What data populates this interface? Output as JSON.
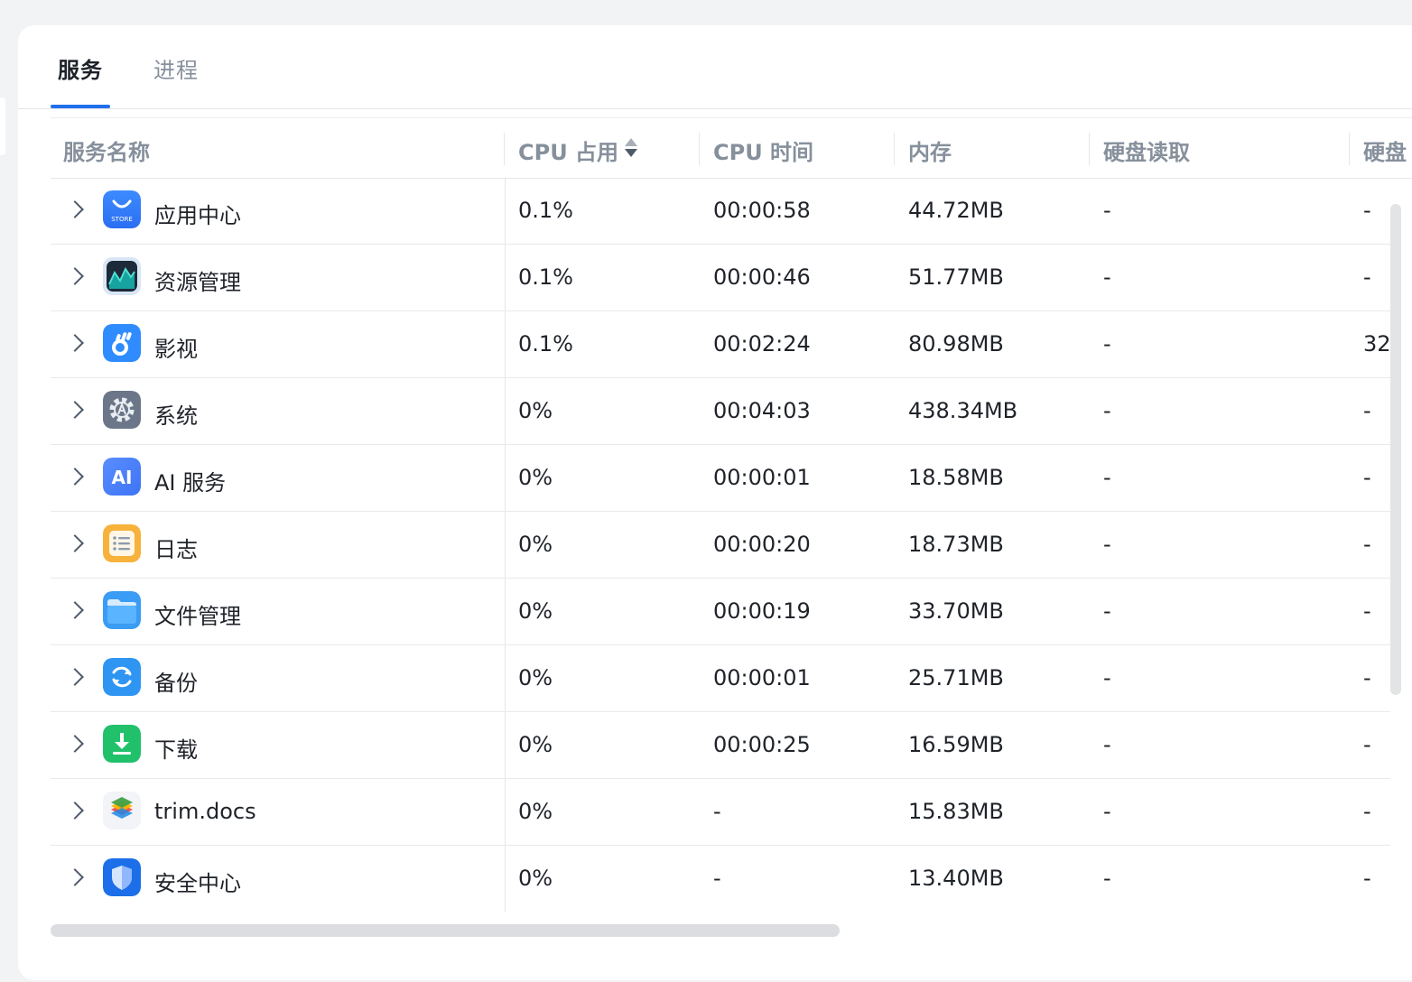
{
  "tabs": [
    {
      "label": "服务",
      "active": true
    },
    {
      "label": "进程",
      "active": false
    }
  ],
  "columns": {
    "name": "服务名称",
    "cpu": "CPU 占用",
    "cpu_time": "CPU 时间",
    "memory": "内存",
    "disk_read": "硬盘读取",
    "disk_write": "硬盘"
  },
  "rows": [
    {
      "name": "应用中心",
      "icon": "app-store-icon",
      "cpu": "0.1%",
      "time": "00:00:58",
      "mem": "44.72MB",
      "read": "-",
      "write": "-"
    },
    {
      "name": "资源管理",
      "icon": "resource-monitor-icon",
      "cpu": "0.1%",
      "time": "00:00:46",
      "mem": "51.77MB",
      "read": "-",
      "write": "-"
    },
    {
      "name": "影视",
      "icon": "video-icon",
      "cpu": "0.1%",
      "time": "00:02:24",
      "mem": "80.98MB",
      "read": "-",
      "write": "32"
    },
    {
      "name": "系统",
      "icon": "system-gear-icon",
      "cpu": "0%",
      "time": "00:04:03",
      "mem": "438.34MB",
      "read": "-",
      "write": "-"
    },
    {
      "name": "AI 服务",
      "icon": "ai-icon",
      "cpu": "0%",
      "time": "00:00:01",
      "mem": "18.58MB",
      "read": "-",
      "write": "-"
    },
    {
      "name": "日志",
      "icon": "log-icon",
      "cpu": "0%",
      "time": "00:00:20",
      "mem": "18.73MB",
      "read": "-",
      "write": "-"
    },
    {
      "name": "文件管理",
      "icon": "folder-icon",
      "cpu": "0%",
      "time": "00:00:19",
      "mem": "33.70MB",
      "read": "-",
      "write": "-"
    },
    {
      "name": "备份",
      "icon": "backup-icon",
      "cpu": "0%",
      "time": "00:00:01",
      "mem": "25.71MB",
      "read": "-",
      "write": "-"
    },
    {
      "name": "下载",
      "icon": "download-icon",
      "cpu": "0%",
      "time": "00:00:25",
      "mem": "16.59MB",
      "read": "-",
      "write": "-"
    },
    {
      "name": "trim.docs",
      "icon": "docs-layers-icon",
      "cpu": "0%",
      "time": "-",
      "mem": "15.83MB",
      "read": "-",
      "write": "-"
    },
    {
      "name": "安全中心",
      "icon": "shield-icon",
      "cpu": "0%",
      "time": "-",
      "mem": "13.40MB",
      "read": "-",
      "write": "-"
    }
  ],
  "store_icon_text": "STORE",
  "ai_icon_text": "AI"
}
